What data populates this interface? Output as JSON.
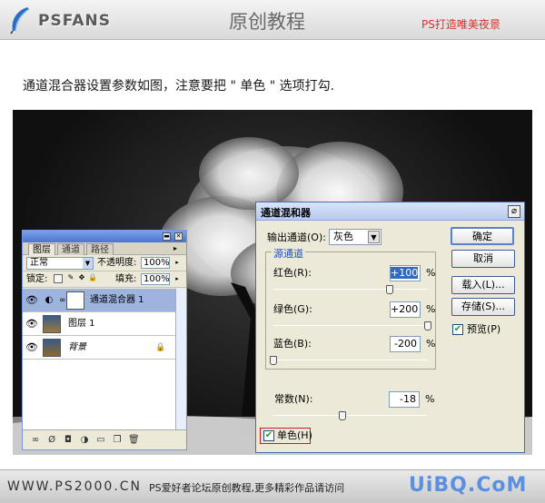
{
  "header": {
    "logo_text": "PSFANS",
    "title": "原创教程",
    "tagline": "PS打造唯美夜景"
  },
  "intro": "通道混合器设置参数如图，注意要把 \" 单色 \" 选项打勾.",
  "layers_panel": {
    "tabs": [
      {
        "label": "图层",
        "active": true
      },
      {
        "label": "通道",
        "active": false
      },
      {
        "label": "路径",
        "active": false
      }
    ],
    "blend_mode": "正常",
    "opacity_label": "不透明度:",
    "opacity_value": "100%",
    "lock_label": "锁定:",
    "fill_label": "填充:",
    "fill_value": "100%",
    "layers": [
      {
        "name": "通道混合器 1",
        "selected": true
      },
      {
        "name": "图层 1",
        "selected": false
      },
      {
        "name": "背景",
        "selected": false
      }
    ]
  },
  "dialog": {
    "title": "通道混和器",
    "close_label": "⌀",
    "output_channel_label": "输出通道(O):",
    "output_channel_value": "灰色",
    "source_group_title": "源通道",
    "red_label": "红色(R):",
    "red_value": "+100",
    "green_label": "绿色(G):",
    "green_value": "+200",
    "blue_label": "蓝色(B):",
    "blue_value": "-200",
    "constant_label": "常数(N):",
    "constant_value": "-18",
    "percent": "%",
    "monochrome_label": "单色(H)",
    "preview_label": "预览(P)",
    "buttons": {
      "ok": "确定",
      "cancel": "取消",
      "load": "载入(L)...",
      "save": "存储(S)..."
    },
    "slider_levels": {
      "red": 100,
      "green": 200,
      "blue": -200,
      "constant": -18
    }
  },
  "footer": {
    "url": "WWW.PS2000.CN",
    "text": "PS爱好者论坛原创教程,更多精彩作品请访问",
    "watermark": "UiBQ.CoM"
  },
  "colors": {
    "accent_red": "#d8322a",
    "selection_blue": "#9eb3de",
    "group_title_blue": "#1f4fbf"
  }
}
